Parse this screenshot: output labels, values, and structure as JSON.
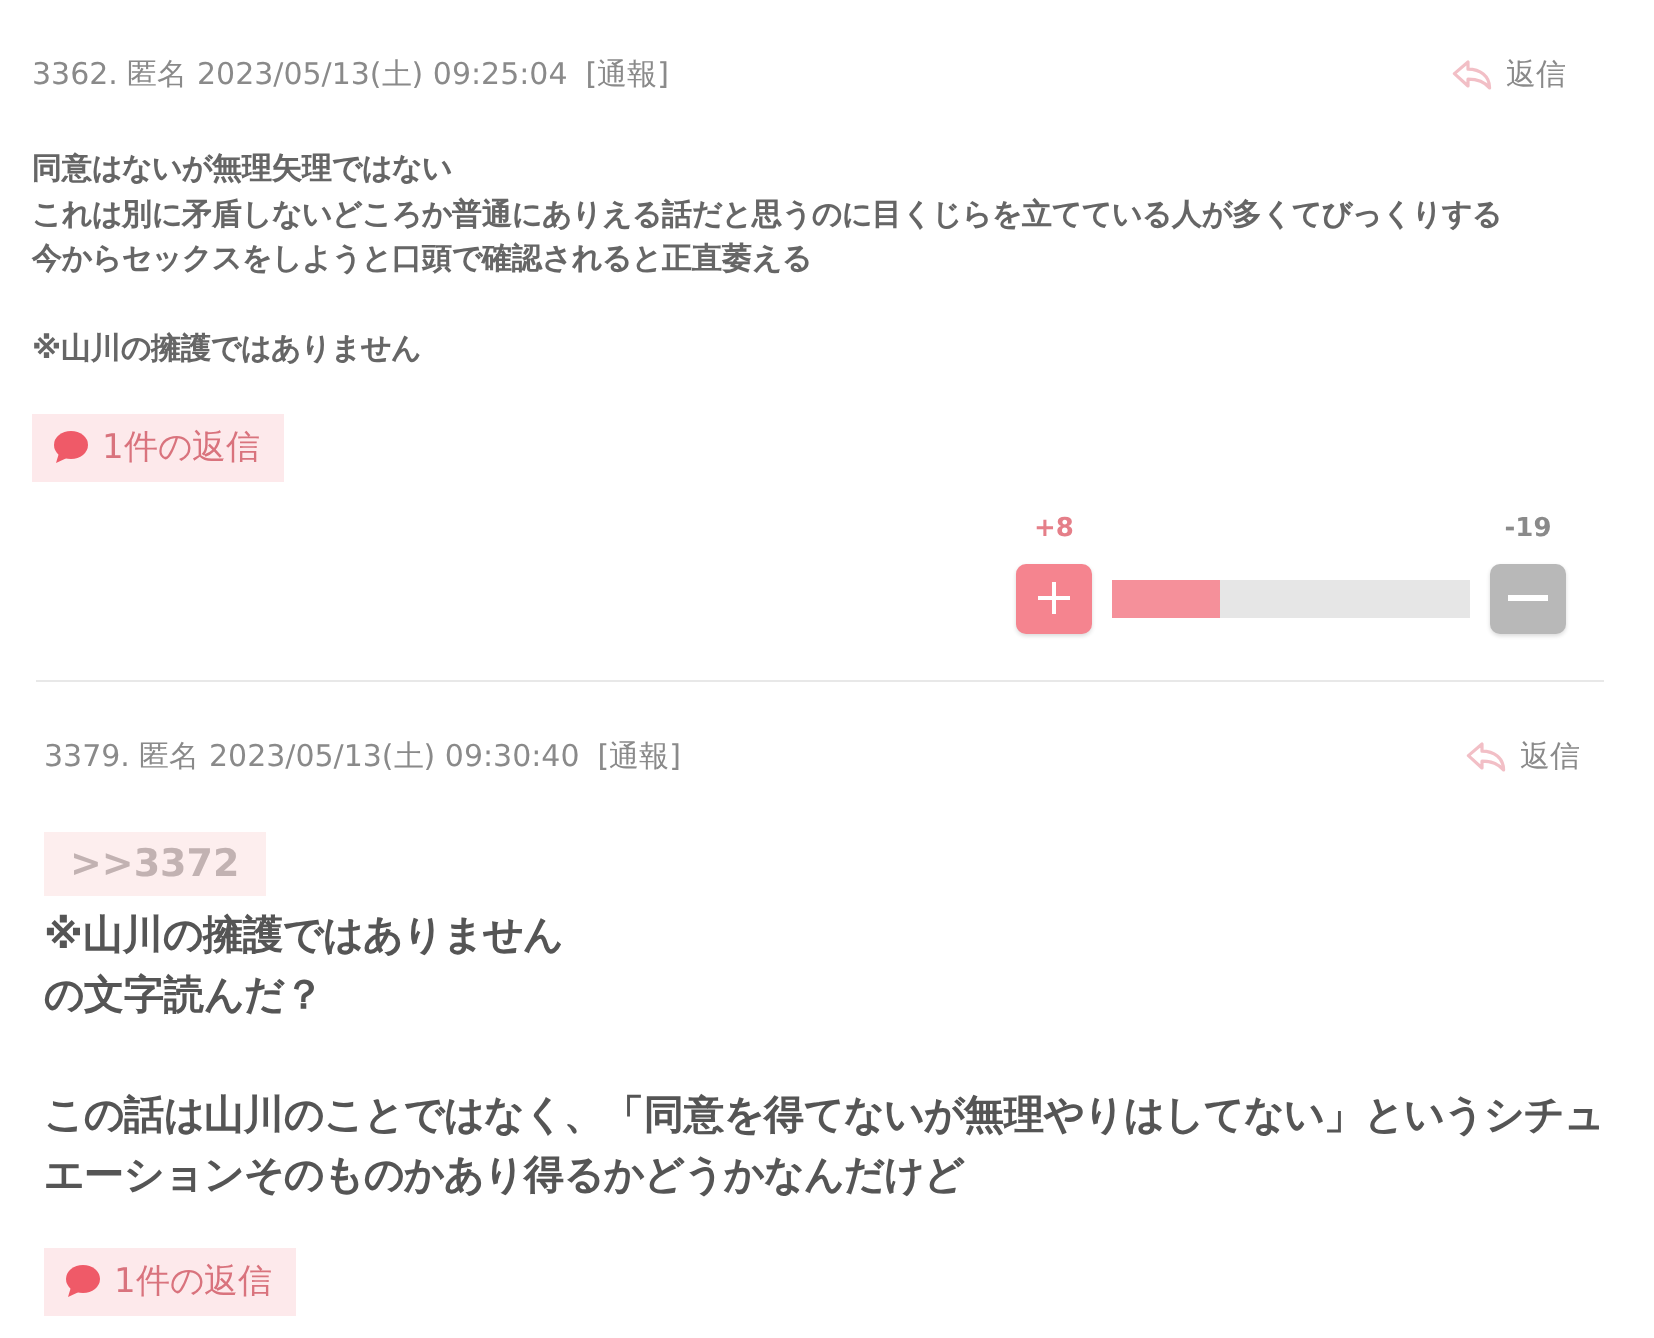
{
  "posts": [
    {
      "kind": "normal",
      "number": "3362.",
      "name": "匿名",
      "datetime": "2023/05/13(土) 09:25:04",
      "report": "[通報]",
      "reply_label": "返信",
      "paragraphs": [
        [
          "同意はないが無理矢理ではない",
          "これは別に矛盾しないどころか普通にありえる話だと思うのに目くじらを立てている人が多くてびっくりする",
          "今からセックスをしようと口頭で確認されると正直萎える"
        ],
        [
          "※山川の擁護ではありません"
        ]
      ],
      "reply_count": "1件の返信",
      "votes": {
        "plus_count": "+8",
        "minus_count": "-19",
        "level": 0.3
      }
    },
    {
      "kind": "large",
      "number": "3379.",
      "name": "匿名",
      "datetime": "2023/05/13(土) 09:30:40",
      "report": "[通報]",
      "reply_label": "返信",
      "anchor": ">>3372",
      "paragraphs": [
        [
          "※山川の擁護ではありません",
          "の文字読んだ？"
        ],
        [
          "この話は山川のことではなく、「同意を得てないが無理やりはしてない」というシチュ",
          "エーションそのものかあり得るかどうかなんだけど"
        ]
      ],
      "reply_count": "1件の返信"
    }
  ]
}
